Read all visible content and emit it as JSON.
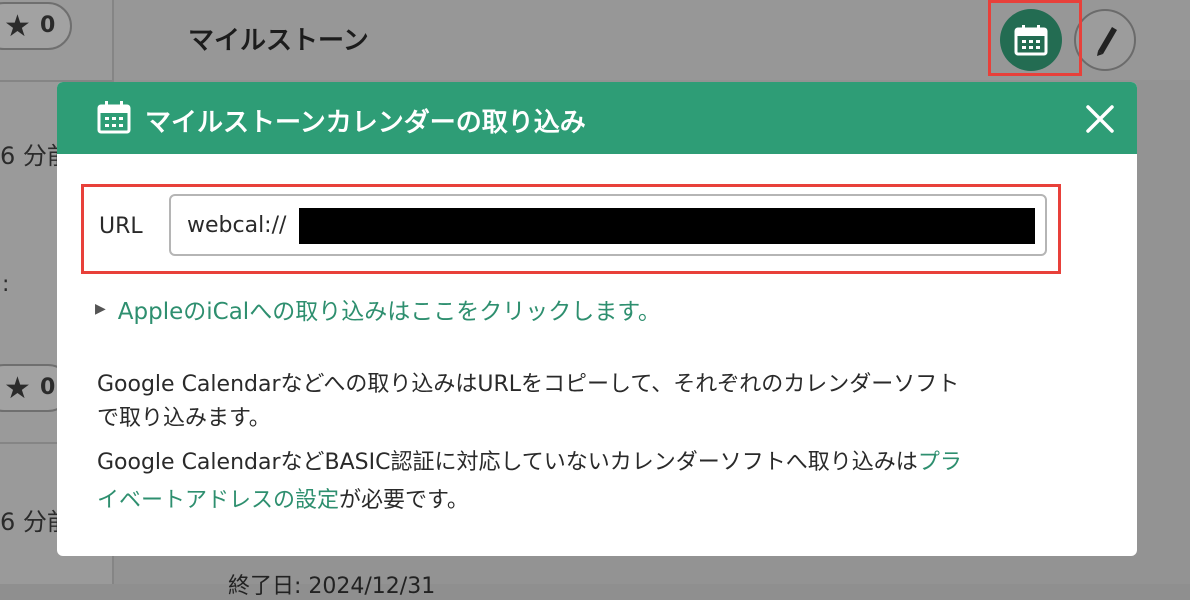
{
  "background": {
    "page_title": "マイルストーン",
    "star_counts": [
      "0",
      "0"
    ],
    "time_labels": [
      "6 分前",
      "6 分前"
    ],
    "footer_text": "終了日: 2024/12/31"
  },
  "modal": {
    "title": "マイルストーンカレンダーの取り込み",
    "url_label": "URL",
    "url_value": "webcal://",
    "ical_link": "AppleのiCalへの取り込みはここをクリックします。",
    "description_line1": "Google Calendarなどへの取り込みはURLをコピーして、それぞれのカレンダーソフト",
    "description_line2": "で取り込みます。",
    "description_line3_text": "Google CalendarなどBASIC認証に対応していないカレンダーソフトへ取り込みは",
    "description_line3_link": "プラ",
    "description_line4_link": "イベートアドレスの設定",
    "description_line4_text": "が必要です。"
  },
  "colors": {
    "header_green": "#2e9d76",
    "link_green": "#2e8f6f",
    "calendar_button": "#236c52",
    "highlight_red": "#e8403a"
  },
  "icons": [
    "star-icon",
    "calendar-icon",
    "pencil-icon",
    "close-icon",
    "triangle-right-icon"
  ]
}
